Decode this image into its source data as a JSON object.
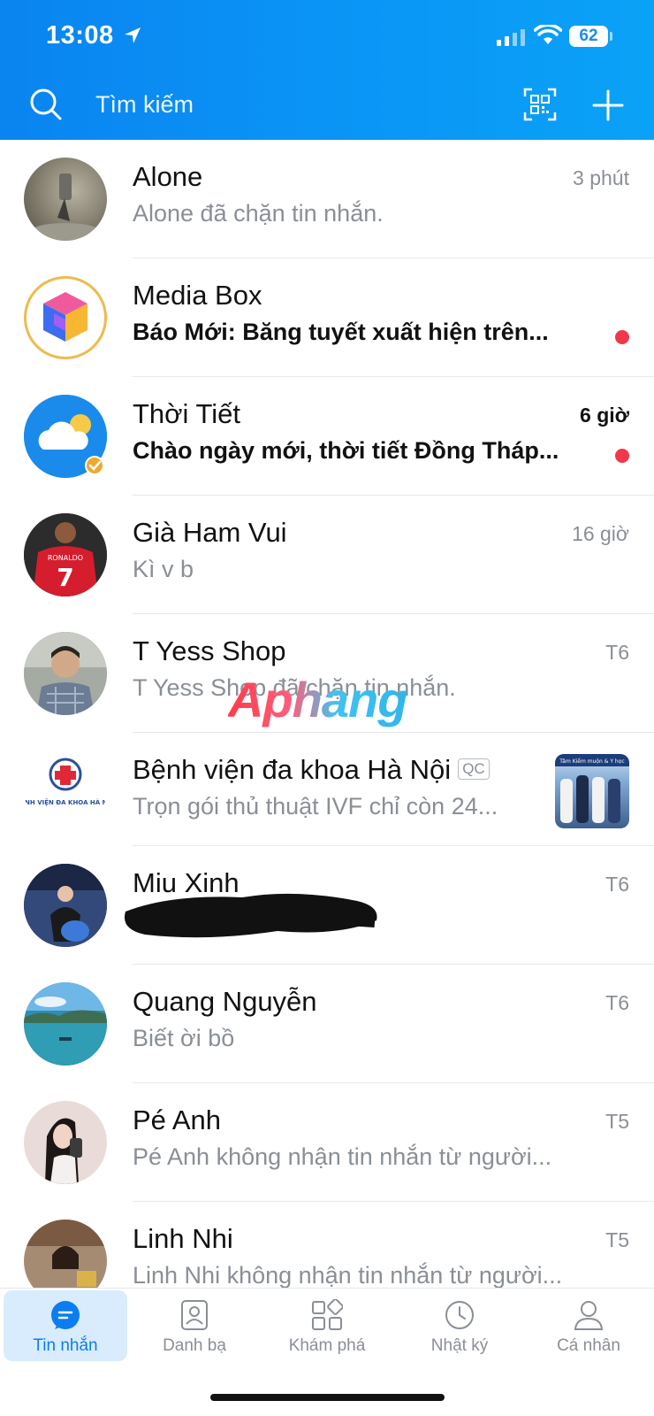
{
  "status_bar": {
    "time": "13:08",
    "battery": "62"
  },
  "header": {
    "search_label": "Tìm kiếm"
  },
  "conversations": [
    {
      "name": "Alone",
      "preview": "Alone đã chặn tin nhắn.",
      "time": "3 phút",
      "unread": false
    },
    {
      "name": "Media Box",
      "preview": "Báo Mới: Băng tuyết xuất hiện trên...",
      "time": "",
      "unread": true
    },
    {
      "name": "Thời Tiết",
      "preview": "Chào ngày mới, thời tiết Đồng Tháp...",
      "time": "6 giờ",
      "unread": true
    },
    {
      "name": "Già Ham Vui",
      "preview": "Kì v b",
      "time": "16 giờ",
      "unread": false
    },
    {
      "name": "T Yess Shop",
      "preview": "T Yess Shop đã chặn tin nhắn.",
      "time": "T6",
      "unread": false
    },
    {
      "name": "Bệnh viện đa khoa Hà Nội",
      "badge": "QC",
      "preview": "Trọn gói thủ thuật IVF chỉ còn 24...",
      "time": "",
      "unread": false,
      "avatar_text": "BỆNH VIỆN ĐA KHOA HÀ NỘI",
      "thumb_text": "Tâm Kiếm muộn & Y học"
    },
    {
      "name": "Miu Xinh",
      "preview": "",
      "time": "T6",
      "unread": false
    },
    {
      "name": "Quang Nguyễn",
      "preview": "Biết ời bồ",
      "time": "T6",
      "unread": false
    },
    {
      "name": "Pé Anh",
      "preview": "Pé Anh không nhận tin nhắn từ người...",
      "time": "T5",
      "unread": false
    },
    {
      "name": "Linh Nhi",
      "preview": "Linh Nhi không nhận tin nhắn từ người...",
      "time": "T5",
      "unread": false
    }
  ],
  "avatar_labels": {
    "jersey_name": "RONALDO",
    "jersey_number": "7"
  },
  "watermark": "Aphang",
  "tabs": [
    {
      "label": "Tin nhắn",
      "active": true
    },
    {
      "label": "Danh bạ",
      "active": false
    },
    {
      "label": "Khám phá",
      "active": false
    },
    {
      "label": "Nhật ký",
      "active": false
    },
    {
      "label": "Cá nhân",
      "active": false
    }
  ],
  "colors": {
    "header_blue": "#0a8ef2",
    "unread_dot": "#f0384a",
    "active_tab_bg": "#d9ecfd",
    "active_tab_text": "#0a7ef0"
  },
  "icons": [
    "location-arrow-icon",
    "signal-icon",
    "wifi-icon",
    "search-icon",
    "qr-code-icon",
    "plus-icon",
    "chat-bubble-icon",
    "contacts-icon",
    "grid-icon",
    "clock-icon",
    "person-icon"
  ]
}
